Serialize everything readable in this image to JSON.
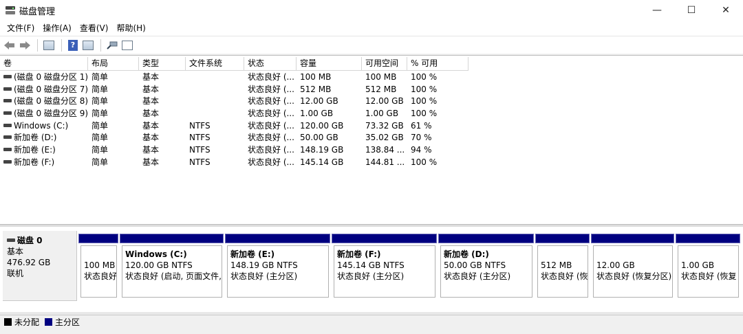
{
  "window": {
    "title": "磁盘管理",
    "minimize": "—",
    "maximize": "☐",
    "close": "✕"
  },
  "menu": [
    "文件(F)",
    "操作(A)",
    "查看(V)",
    "帮助(H)"
  ],
  "toolbar": {
    "icons": [
      "back-arrow-icon",
      "forward-arrow-icon",
      "properties-icon",
      "help-icon",
      "view-icon",
      "connect-icon",
      "settings-icon"
    ]
  },
  "list": {
    "columns": [
      "卷",
      "布局",
      "类型",
      "文件系统",
      "状态",
      "容量",
      "可用空间",
      "% 可用"
    ],
    "rows": [
      [
        "(磁盘 0 磁盘分区 1)",
        "简单",
        "基本",
        "",
        "状态良好 (...",
        "100 MB",
        "100 MB",
        "100 %"
      ],
      [
        "(磁盘 0 磁盘分区 7)",
        "简单",
        "基本",
        "",
        "状态良好 (...",
        "512 MB",
        "512 MB",
        "100 %"
      ],
      [
        "(磁盘 0 磁盘分区 8)",
        "简单",
        "基本",
        "",
        "状态良好 (...",
        "12.00 GB",
        "12.00 GB",
        "100 %"
      ],
      [
        "(磁盘 0 磁盘分区 9)",
        "简单",
        "基本",
        "",
        "状态良好 (...",
        "1.00 GB",
        "1.00 GB",
        "100 %"
      ],
      [
        "Windows (C:)",
        "简单",
        "基本",
        "NTFS",
        "状态良好 (...",
        "120.00 GB",
        "73.32 GB",
        "61 %"
      ],
      [
        "新加卷 (D:)",
        "简单",
        "基本",
        "NTFS",
        "状态良好 (...",
        "50.00 GB",
        "35.02 GB",
        "70 %"
      ],
      [
        "新加卷 (E:)",
        "简单",
        "基本",
        "NTFS",
        "状态良好 (...",
        "148.19 GB",
        "138.84 ...",
        "94 %"
      ],
      [
        "新加卷 (F:)",
        "简单",
        "基本",
        "NTFS",
        "状态良好 (...",
        "145.14 GB",
        "144.81 ...",
        "100 %"
      ]
    ]
  },
  "disk": {
    "name": "磁盘 0",
    "type": "基本",
    "size": "476.92 GB",
    "status": "联机",
    "partitions": [
      {
        "name": "",
        "size": "100 MB",
        "status": "状态良好"
      },
      {
        "name": "Windows  (C:)",
        "size": "120.00 GB NTFS",
        "status": "状态良好 (启动, 页面文件,"
      },
      {
        "name": "新加卷  (E:)",
        "size": "148.19 GB NTFS",
        "status": "状态良好 (主分区)"
      },
      {
        "name": "新加卷  (F:)",
        "size": "145.14 GB NTFS",
        "status": "状态良好 (主分区)"
      },
      {
        "name": "新加卷  (D:)",
        "size": "50.00 GB NTFS",
        "status": "状态良好 (主分区)"
      },
      {
        "name": "",
        "size": "512 MB",
        "status": "状态良好 (恢"
      },
      {
        "name": "",
        "size": "12.00 GB",
        "status": "状态良好 (恢复分区)"
      },
      {
        "name": "",
        "size": "1.00 GB",
        "status": "状态良好 (恢复"
      }
    ]
  },
  "legend": [
    {
      "label": "未分配",
      "color": "#000000"
    },
    {
      "label": "主分区",
      "color": "#000080"
    }
  ]
}
